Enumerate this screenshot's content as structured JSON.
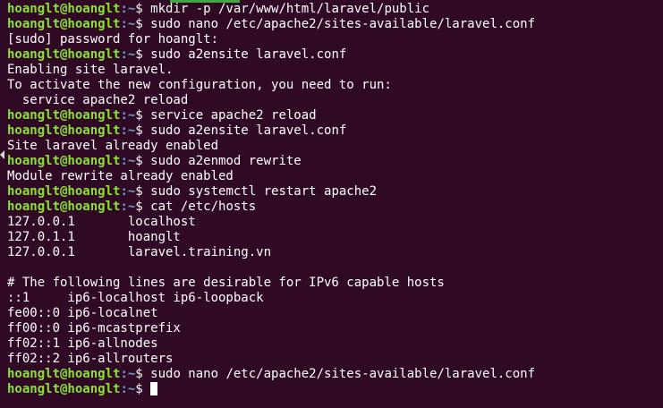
{
  "terminal": {
    "colors": {
      "background": "#300a24",
      "prompt_user": "#8ae234",
      "prompt_path": "#729fcf",
      "text": "#ffffff"
    },
    "lines": [
      {
        "type": "prompt",
        "user": "hoanglt@hoanglt",
        "path": ":~",
        "sym": "$ ",
        "cmd": "mkdir -p /var/www/html/laravel/public"
      },
      {
        "type": "prompt",
        "user": "hoanglt@hoanglt",
        "path": ":~",
        "sym": "$ ",
        "cmd": "sudo nano /etc/apache2/sites-available/laravel.conf"
      },
      {
        "type": "output",
        "text": "[sudo] password for hoanglt:"
      },
      {
        "type": "prompt",
        "user": "hoanglt@hoanglt",
        "path": ":~",
        "sym": "$ ",
        "cmd": "sudo a2ensite laravel.conf"
      },
      {
        "type": "output",
        "text": "Enabling site laravel."
      },
      {
        "type": "output",
        "text": "To activate the new configuration, you need to run:"
      },
      {
        "type": "output",
        "text": "  service apache2 reload"
      },
      {
        "type": "prompt",
        "user": "hoanglt@hoanglt",
        "path": ":~",
        "sym": "$ ",
        "cmd": "service apache2 reload"
      },
      {
        "type": "prompt",
        "user": "hoanglt@hoanglt",
        "path": ":~",
        "sym": "$ ",
        "cmd": "sudo a2ensite laravel.conf"
      },
      {
        "type": "output",
        "text": "Site laravel already enabled"
      },
      {
        "type": "prompt",
        "user": "hoanglt@hoanglt",
        "path": ":~",
        "sym": "$ ",
        "cmd": "sudo a2enmod rewrite"
      },
      {
        "type": "output",
        "text": "Module rewrite already enabled"
      },
      {
        "type": "prompt",
        "user": "hoanglt@hoanglt",
        "path": ":~",
        "sym": "$ ",
        "cmd": "sudo systemctl restart apache2"
      },
      {
        "type": "prompt",
        "user": "hoanglt@hoanglt",
        "path": ":~",
        "sym": "$ ",
        "cmd": "cat /etc/hosts"
      },
      {
        "type": "output",
        "text": "127.0.0.1       localhost"
      },
      {
        "type": "output",
        "text": "127.0.1.1       hoanglt"
      },
      {
        "type": "output",
        "text": "127.0.0.1       laravel.training.vn"
      },
      {
        "type": "output",
        "text": ""
      },
      {
        "type": "output",
        "text": "# The following lines are desirable for IPv6 capable hosts"
      },
      {
        "type": "output",
        "text": "::1     ip6-localhost ip6-loopback"
      },
      {
        "type": "output",
        "text": "fe00::0 ip6-localnet"
      },
      {
        "type": "output",
        "text": "ff00::0 ip6-mcastprefix"
      },
      {
        "type": "output",
        "text": "ff02::1 ip6-allnodes"
      },
      {
        "type": "output",
        "text": "ff02::2 ip6-allrouters"
      },
      {
        "type": "prompt",
        "user": "hoanglt@hoanglt",
        "path": ":~",
        "sym": "$ ",
        "cmd": "sudo nano /etc/apache2/sites-available/laravel.conf"
      },
      {
        "type": "prompt",
        "user": "hoanglt@hoanglt",
        "path": ":~",
        "sym": "$ ",
        "cmd": "",
        "cursor": true
      }
    ]
  }
}
